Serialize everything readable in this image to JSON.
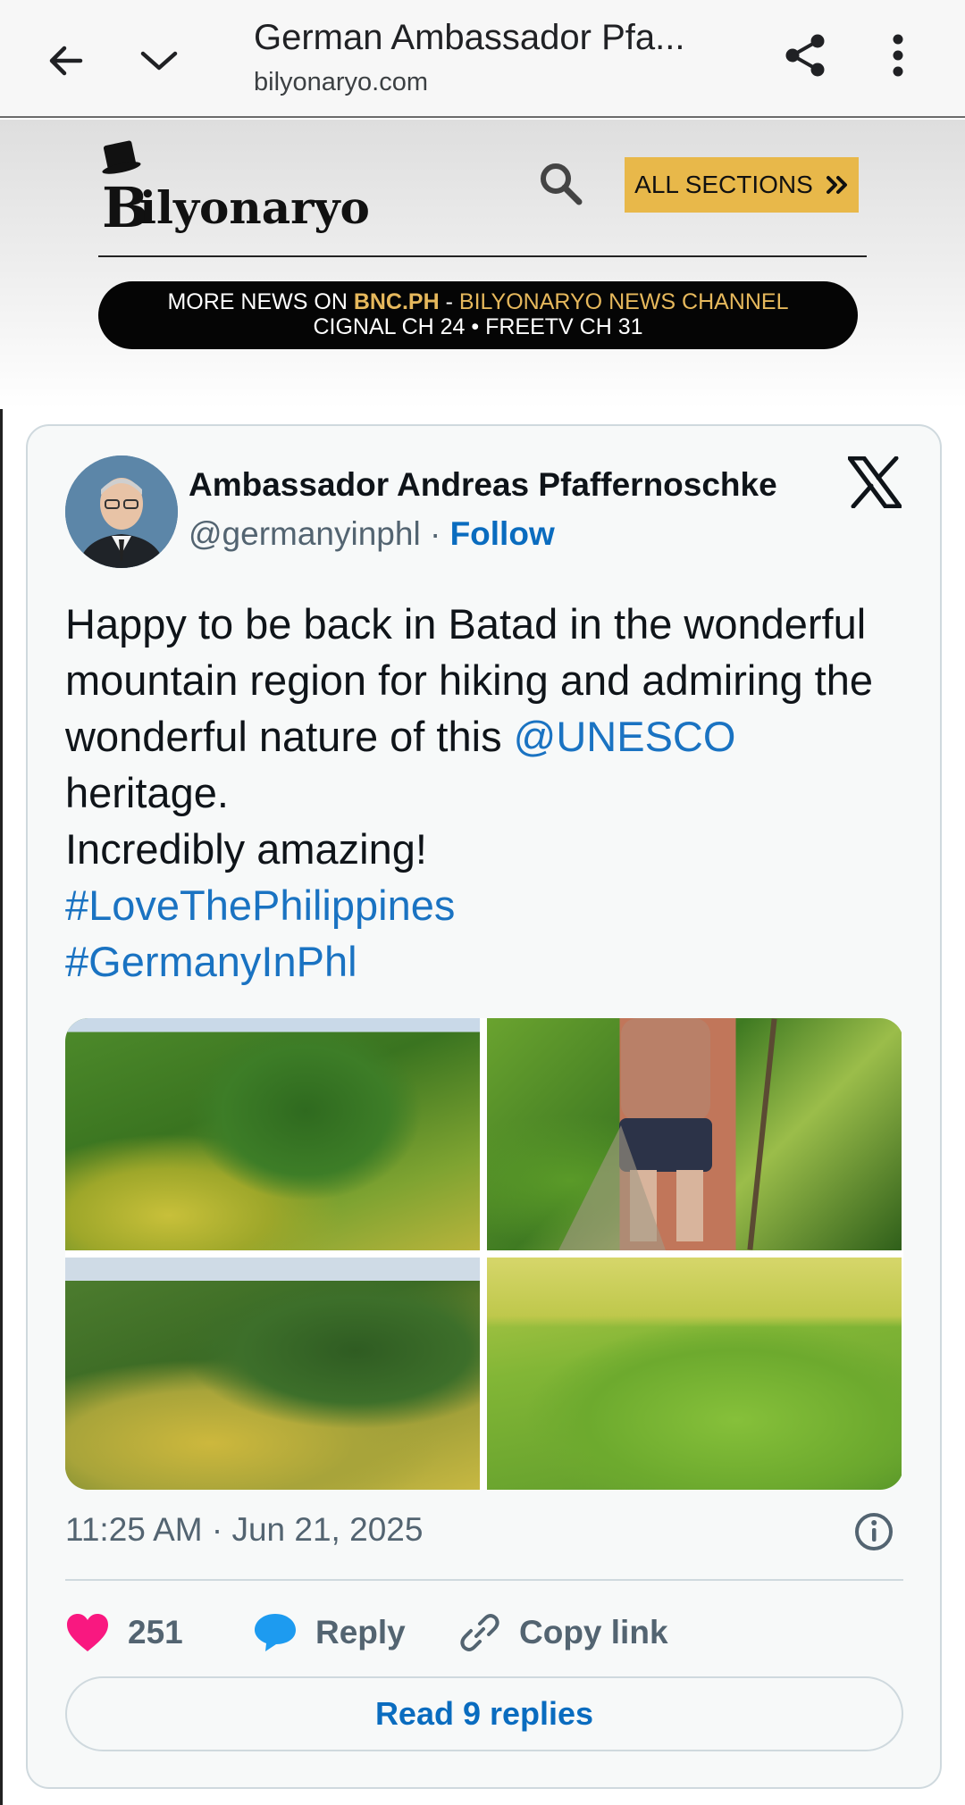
{
  "browser": {
    "title": "German Ambassador Pfa...",
    "url": "bilyonaryo.com"
  },
  "site": {
    "logo_text": "Bilyonaryo",
    "sections_label": "ALL SECTIONS",
    "news_banner": {
      "prefix": "MORE NEWS ON ",
      "site": "BNC.PH",
      "dash": " - ",
      "channel": "BILYONARYO NEWS CHANNEL",
      "line2": "CIGNAL CH 24 • FREETV CH 31"
    }
  },
  "tweet": {
    "author_name": "Ambassador Andreas Pfaffernoschke",
    "handle": "@germanyinphl",
    "separator": " · ",
    "follow_label": "Follow",
    "text": {
      "part1": "Happy to be back in Batad in the wonderful mountain region for hiking and admiring the wonderful nature of this ",
      "mention": "@UNESCO",
      "part2": " heritage.",
      "line2": "Incredibly amazing!",
      "hashtag1": "#LoveThePhilippines",
      "hashtag2": "#GermanyInPhl"
    },
    "timestamp": "11:25 AM · Jun 21, 2025",
    "likes": "251",
    "reply_label": "Reply",
    "copy_link_label": "Copy link",
    "read_replies_label": "Read 9 replies"
  },
  "icons": {
    "back": "back-arrow-icon",
    "dropdown": "chevron-down-icon",
    "share": "share-icon",
    "menu": "more-vert-icon",
    "search": "search-icon",
    "x": "x-logo-icon",
    "info": "info-icon",
    "heart": "heart-icon",
    "reply": "reply-bubble-icon",
    "link": "link-icon"
  },
  "colors": {
    "accent_gold": "#e8b84a",
    "link_blue": "#1a73c2",
    "heart_pink": "#f91880",
    "reply_blue": "#1d9bf0"
  }
}
